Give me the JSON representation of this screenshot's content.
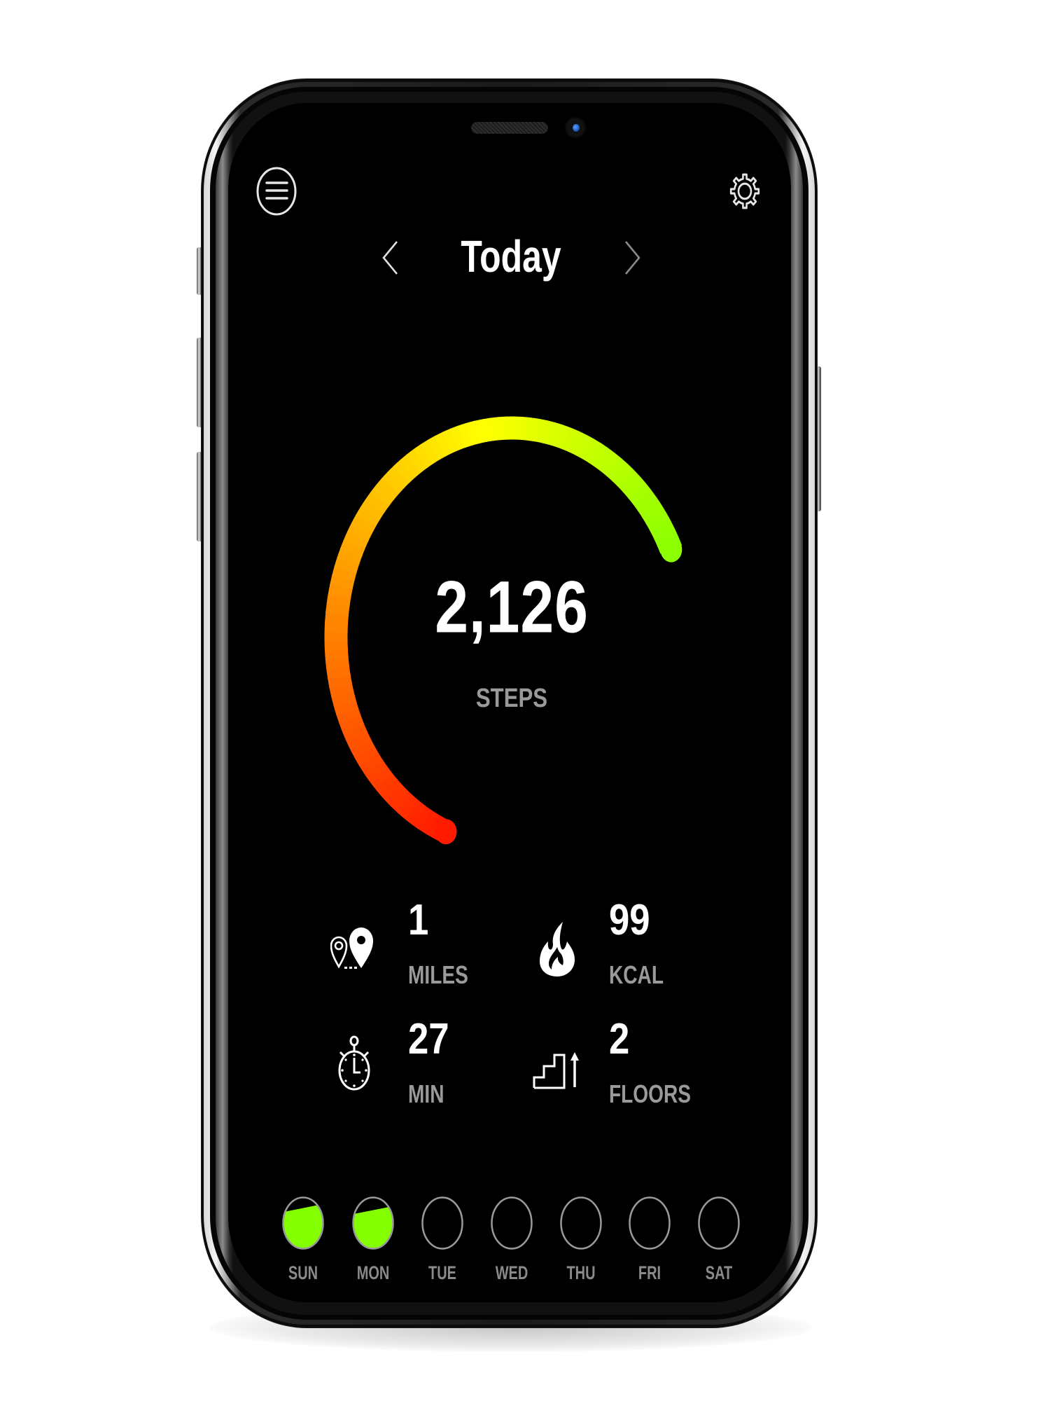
{
  "header": {
    "menu_icon": "hamburger-menu-icon",
    "settings_icon": "gear-icon",
    "title": "Today",
    "prev_icon": "chevron-left-icon",
    "next_icon": "chevron-right-icon"
  },
  "gauge": {
    "steps_value": "2,126",
    "steps_label": "STEPS",
    "progress_fraction": 0.62,
    "gradient_colors": [
      "#ff1a00",
      "#ff8a00",
      "#ffff00",
      "#8cff00"
    ]
  },
  "stats": [
    {
      "icon": "map-pins-route-icon",
      "value": "1",
      "unit": "MILES"
    },
    {
      "icon": "flame-icon",
      "value": "99",
      "unit": "KCAL"
    },
    {
      "icon": "stopwatch-icon",
      "value": "27",
      "unit": "MIN"
    },
    {
      "icon": "stairs-up-icon",
      "value": "2",
      "unit": "FLOORS"
    }
  ],
  "week": {
    "fill_color": "#84ff00",
    "days": [
      {
        "label": "SUN",
        "fill": 0.8
      },
      {
        "label": "MON",
        "fill": 0.76
      },
      {
        "label": "TUE",
        "fill": 0
      },
      {
        "label": "WED",
        "fill": 0
      },
      {
        "label": "THU",
        "fill": 0
      },
      {
        "label": "FRI",
        "fill": 0
      },
      {
        "label": "SAT",
        "fill": 0
      }
    ]
  }
}
